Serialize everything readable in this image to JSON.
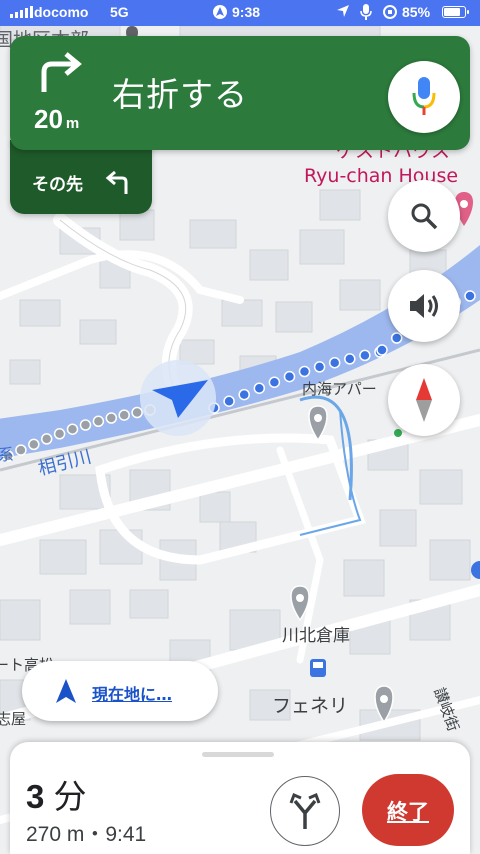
{
  "status_bar": {
    "carrier": "docomo",
    "network": "5G",
    "time": "9:38",
    "battery": "85%",
    "battery_level": 0.85
  },
  "navigation": {
    "maneuver_icon": "turn-right-icon",
    "instruction": "右折する",
    "distance_value": "20",
    "distance_unit": "m",
    "next_label": "その先",
    "next_maneuver_icon": "turn-left-icon"
  },
  "map_labels": {
    "top_partial": "国地区本部",
    "guesthouse_jp": "ゲストハウス",
    "guesthouse_en": "Ryu-chan House",
    "river": "相引川",
    "apartment": "内海アパー",
    "warehouse": "川北倉庫",
    "store": "フェネリ",
    "left_partial_1": "ート高松",
    "left_partial_2": "志屋",
    "right_partial": "讃岐街",
    "edge_partial": "系"
  },
  "controls": {
    "search_icon": "search-icon",
    "sound_icon": "speaker-icon",
    "compass_icon": "compass-icon",
    "voice_icon": "microphone-icon",
    "recenter_label": "現在地に…",
    "recenter_icon": "navigation-arrow-icon"
  },
  "trip": {
    "eta_minutes": "3",
    "eta_unit": "分",
    "distance_time": "270 m・9:41",
    "routes_icon": "alternate-routes-icon",
    "exit_label": "終了"
  },
  "colors": {
    "status_bar": "#4a74f0",
    "nav_green": "#2c7a3c",
    "nav_dark_green": "#1f5a2a",
    "river": "#9db8ef",
    "route_blue": "#3b73e0",
    "exit_red": "#d0392f",
    "link_blue": "#1a52c8"
  }
}
